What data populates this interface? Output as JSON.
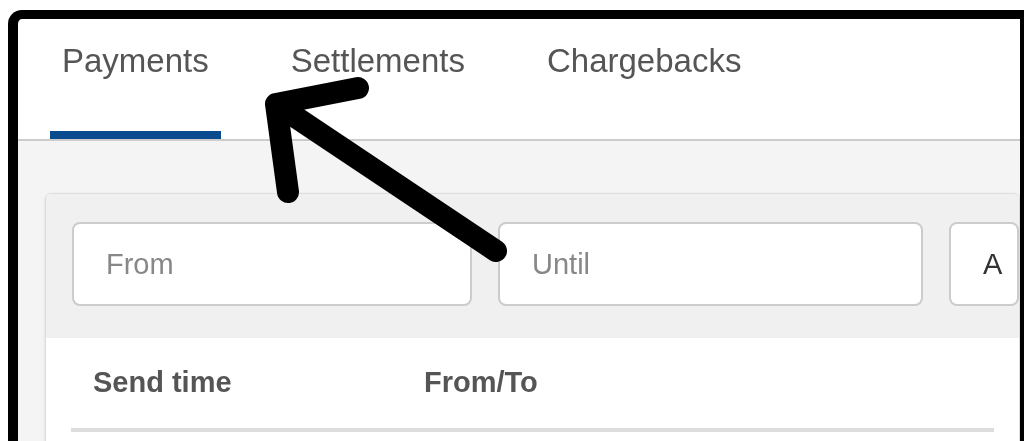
{
  "tabs": [
    {
      "label": "Payments",
      "selected": true
    },
    {
      "label": "Settlements",
      "selected": false
    },
    {
      "label": "Chargebacks",
      "selected": false
    }
  ],
  "filters": [
    {
      "placeholder": "From"
    },
    {
      "placeholder": "Until"
    },
    {
      "value": "A"
    }
  ],
  "table": {
    "columns": [
      "Send time",
      "From/To"
    ]
  }
}
